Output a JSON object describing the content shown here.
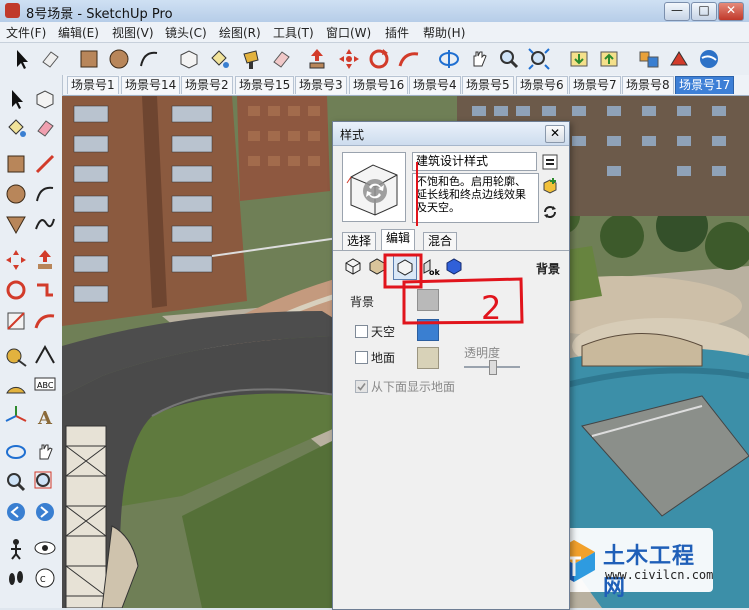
{
  "window": {
    "title": "8号场景 - SketchUp Pro",
    "controls": [
      "—",
      "□",
      "✕"
    ]
  },
  "menu": [
    "文件(F)",
    "编辑(E)",
    "视图(V)",
    "镜头(C)",
    "绘图(R)",
    "工具(T)",
    "窗口(W)",
    "插件",
    "帮助(H)"
  ],
  "toolbar_icons": [
    "select-icon",
    "eraser-icon",
    "rectangle-icon",
    "circle-icon",
    "arc-icon",
    "make-component-icon",
    "paint-bucket-icon",
    "eraser-icon",
    "push-pull-icon",
    "move-icon",
    "rotate-icon",
    "follow-me-icon",
    "orbit-icon",
    "pan-icon",
    "zoom-icon",
    "zoom-extents-icon",
    "get-models-icon",
    "share-model-icon",
    "components-icon",
    "google-earth-icon"
  ],
  "scene_tabs": {
    "items": [
      "场景号1",
      "场景号14",
      "场景号2",
      "场景号15",
      "场景号3",
      "场景号16",
      "场景号4",
      "场景号5",
      "场景号6",
      "场景号7",
      "场景号8",
      "场景号17"
    ],
    "active": "场景号17"
  },
  "styles_dialog": {
    "title": "样式",
    "close": "✕",
    "style_name": "建筑设计样式",
    "style_description": "不饱和色。启用轮廓、延长线和终点边线效果及天空。",
    "tabs": [
      "选择",
      "编辑",
      "混合"
    ],
    "active_tab": "编辑",
    "edit_section": "背景",
    "background": {
      "label": "背景",
      "color": "#b9b9b9"
    },
    "sky": {
      "label": "天空",
      "checked": false,
      "color": "#3a7fd1"
    },
    "ground": {
      "label": "地面",
      "checked": false,
      "color": "#d8d2b8"
    },
    "transparency_label": "透明度",
    "show_ground_from_below": {
      "label": "从下面显示地面",
      "checked": true,
      "enabled": false
    }
  },
  "annotation_text": "2",
  "watermark": {
    "name": "土木工程网",
    "url": "www.civilcn.com"
  }
}
